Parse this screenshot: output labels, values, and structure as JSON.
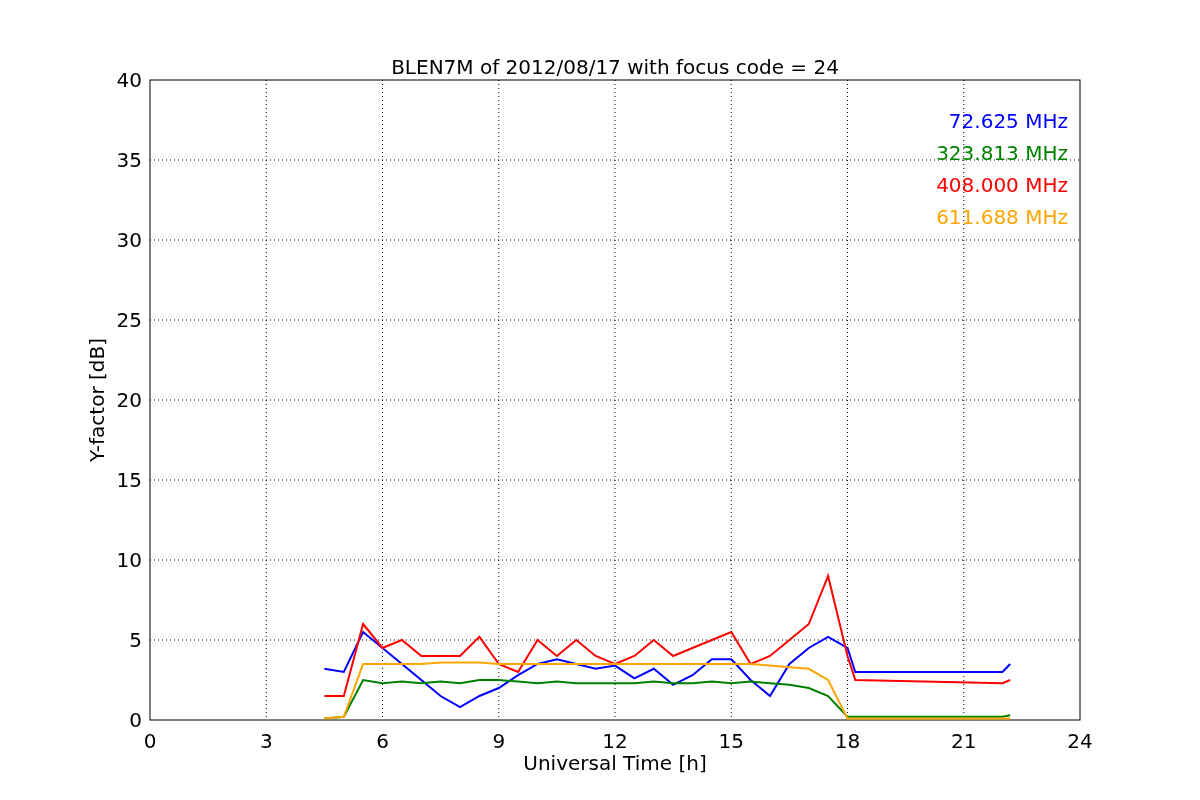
{
  "chart_data": {
    "type": "line",
    "title": "BLEN7M of 2012/08/17 with focus code = 24",
    "xlabel": "Universal Time [h]",
    "ylabel": "Y-factor [dB]",
    "x": [
      4.5,
      5,
      5.5,
      6,
      6.5,
      7,
      7.5,
      8,
      8.5,
      9,
      9.5,
      10,
      10.5,
      11,
      11.5,
      12,
      12.5,
      13,
      13.5,
      14,
      14.5,
      15,
      15.5,
      16,
      16.5,
      17,
      17.5,
      18,
      18.2,
      22,
      22.2
    ],
    "series": [
      {
        "name": "72.625 MHz",
        "color": "#0000ff",
        "values": [
          3.2,
          3.0,
          5.5,
          4.5,
          3.5,
          2.5,
          1.5,
          0.8,
          1.5,
          2.0,
          2.8,
          3.5,
          3.8,
          3.5,
          3.2,
          3.4,
          2.6,
          3.2,
          2.2,
          2.8,
          3.8,
          3.8,
          2.5,
          1.5,
          3.5,
          4.5,
          5.2,
          4.5,
          3.0,
          3.0,
          3.5
        ]
      },
      {
        "name": "323.813 MHz",
        "color": "#008000",
        "values": [
          0.1,
          0.2,
          2.5,
          2.3,
          2.4,
          2.3,
          2.4,
          2.3,
          2.5,
          2.5,
          2.4,
          2.3,
          2.4,
          2.3,
          2.3,
          2.3,
          2.3,
          2.4,
          2.3,
          2.3,
          2.4,
          2.3,
          2.4,
          2.3,
          2.2,
          2.0,
          1.5,
          0.2,
          0.2,
          0.2,
          0.3
        ]
      },
      {
        "name": "408.000 MHz",
        "color": "#ff0000",
        "values": [
          1.5,
          1.5,
          6,
          4.5,
          5,
          4,
          4,
          4,
          5.2,
          3.5,
          3,
          5,
          4,
          5,
          4,
          3.5,
          4,
          5,
          4,
          4.5,
          5,
          5.5,
          3.5,
          4,
          5,
          6,
          9,
          4,
          2.5,
          2.3,
          2.5
        ]
      },
      {
        "name": "611.688 MHz",
        "color": "#ffa500",
        "values": [
          0.1,
          0.2,
          3.5,
          3.5,
          3.5,
          3.5,
          3.6,
          3.6,
          3.6,
          3.5,
          3.5,
          3.5,
          3.5,
          3.5,
          3.5,
          3.5,
          3.5,
          3.5,
          3.5,
          3.5,
          3.5,
          3.5,
          3.5,
          3.4,
          3.3,
          3.2,
          2.5,
          0.1,
          0.1,
          0.1,
          0.1
        ]
      }
    ],
    "grid": true,
    "xlim": [
      0,
      24
    ],
    "ylim": [
      0,
      40
    ],
    "xticks": [
      0,
      3,
      6,
      9,
      12,
      15,
      18,
      21,
      24
    ],
    "yticks": [
      0,
      5,
      10,
      15,
      20,
      25,
      30,
      35,
      40
    ]
  }
}
